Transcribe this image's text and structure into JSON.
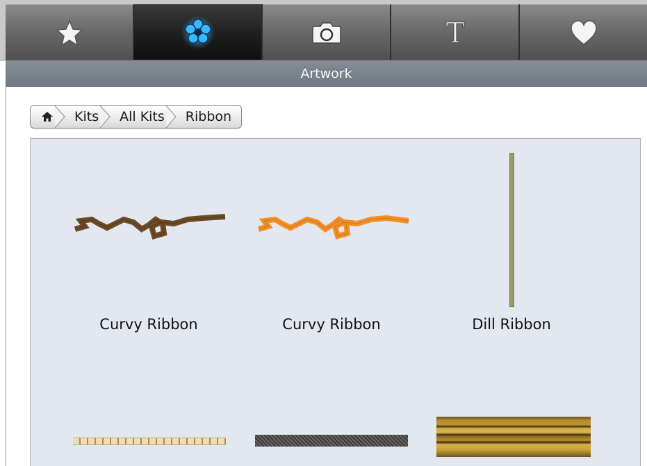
{
  "toolbar": {
    "tabs": [
      {
        "icon": "star-icon",
        "active": false
      },
      {
        "icon": "flower-icon",
        "active": true
      },
      {
        "icon": "camera-icon",
        "active": false
      },
      {
        "icon": "text-icon",
        "glyph": "T",
        "active": false
      },
      {
        "icon": "heart-icon",
        "active": false
      }
    ]
  },
  "header": {
    "title": "Artwork"
  },
  "breadcrumb": {
    "home_icon": "home-icon",
    "items": [
      "Kits",
      "All Kits",
      "Ribbon"
    ]
  },
  "grid": {
    "items": [
      {
        "label": "Curvy Ribbon",
        "color": "#6b4a26"
      },
      {
        "label": "Curvy Ribbon",
        "color": "#f0902a"
      },
      {
        "label": "Dill Ribbon",
        "color": "#9a9a68"
      },
      {
        "label": "",
        "color": "#e9d5a8"
      },
      {
        "label": "",
        "color": "#4a4646"
      },
      {
        "label": "",
        "color": "#8a6a2a"
      }
    ]
  },
  "colors": {
    "active_glow": "#2fb3ff",
    "header_bg": "#78818a",
    "grid_bg": "#e3e8f0"
  }
}
